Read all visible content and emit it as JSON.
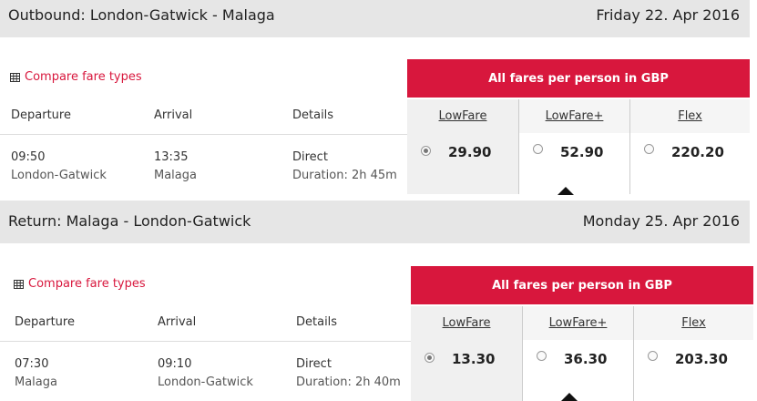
{
  "outbound": {
    "title": "Outbound:  London-Gatwick - Malaga",
    "date": "Friday 22. Apr 2016",
    "compare_label": "Compare fare types",
    "banner": "All fares per person in GBP",
    "columns": {
      "departure": "Departure",
      "arrival": "Arrival",
      "details": "Details"
    },
    "fare_types": [
      "LowFare",
      "LowFare+",
      "Flex"
    ],
    "flight": {
      "dep_time": "09:50",
      "dep_place": "London-Gatwick",
      "arr_time": "13:35",
      "arr_place": "Malaga",
      "type": "Direct",
      "duration": "Duration: 2h 45m"
    },
    "prices": [
      "29.90",
      "52.90",
      "220.20"
    ],
    "selected_fare": "LowFare"
  },
  "return": {
    "title": "Return:  Malaga - London-Gatwick",
    "date": "Monday 25. Apr 2016",
    "compare_label": "Compare fare types",
    "banner": "All fares per person in GBP",
    "columns": {
      "departure": "Departure",
      "arrival": "Arrival",
      "details": "Details"
    },
    "fare_types": [
      "LowFare",
      "LowFare+",
      "Flex"
    ],
    "flight": {
      "dep_time": "07:30",
      "dep_place": "Malaga",
      "arr_time": "09:10",
      "arr_place": "London-Gatwick",
      "type": "Direct",
      "duration": "Duration: 2h 40m"
    },
    "prices": [
      "13.30",
      "36.30",
      "203.30"
    ],
    "selected_fare": "LowFare"
  },
  "colors": {
    "accent": "#d8173d",
    "header_bg": "#e6e6e6",
    "fare_header_bg": "#f0f0f0"
  },
  "icons": {
    "compare": "table-grid-icon",
    "selected_indicator": "triangle-up-icon"
  }
}
